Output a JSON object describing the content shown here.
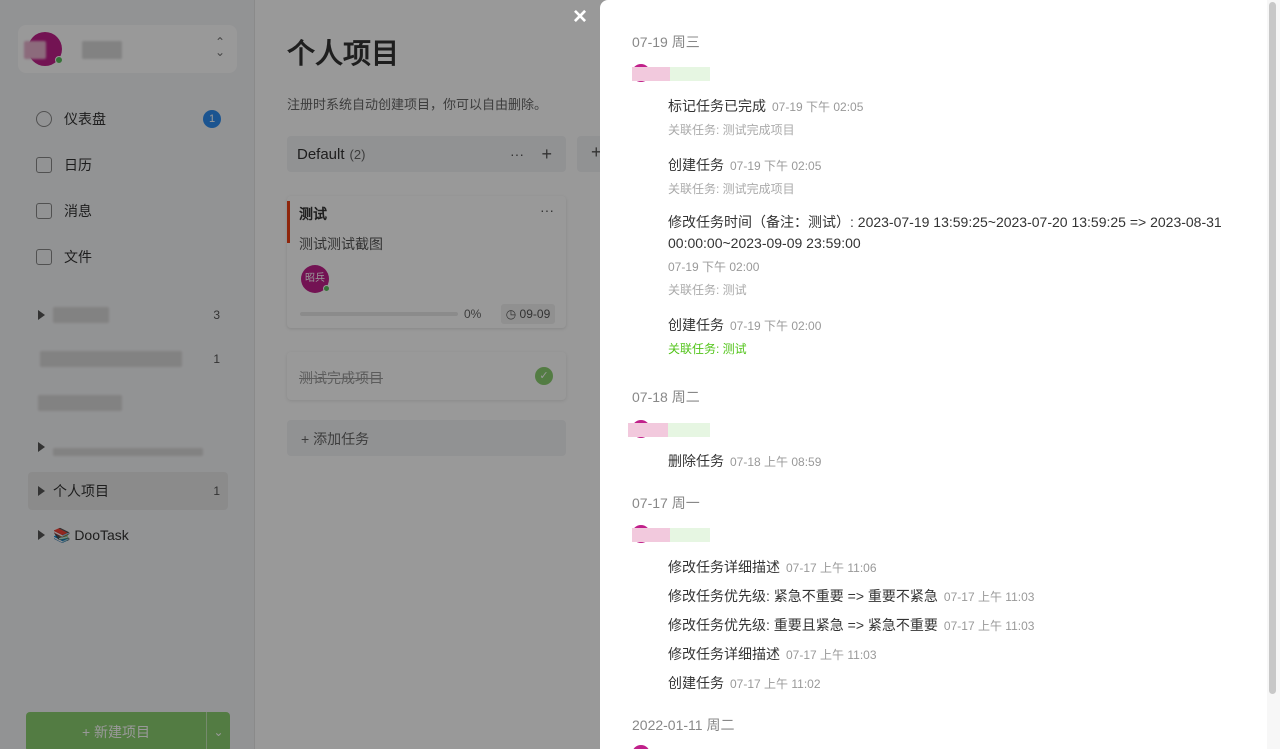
{
  "sidebar": {
    "menu": [
      {
        "label": "仪表盘",
        "badge": "1",
        "icon": "dashboard-icon"
      },
      {
        "label": "日历",
        "icon": "calendar-icon"
      },
      {
        "label": "消息",
        "icon": "message-icon"
      },
      {
        "label": "文件",
        "icon": "file-icon"
      }
    ],
    "projects": [
      {
        "label": "",
        "count": "3"
      },
      {
        "label": "",
        "count": "1"
      },
      {
        "label": "",
        "count": ""
      },
      {
        "label": "",
        "count": ""
      },
      {
        "label": "个人项目",
        "count": "1"
      },
      {
        "label": "📚 DooTask",
        "count": ""
      }
    ],
    "new_project_label": "+  新建项目",
    "new_project_arrow": "⌄"
  },
  "main": {
    "title": "个人项目",
    "description": "注册时系统自动创建项目，你可以自由删除。",
    "column": {
      "name": "Default",
      "count": "(2)",
      "more": "···",
      "add": "+"
    },
    "column2_add": "+",
    "task": {
      "title": "测试",
      "more": "···",
      "desc": "测试测试截图",
      "avatar_text": "昭兵",
      "progress": "0%",
      "progress_value": 0,
      "date": "◷ 09-09"
    },
    "done_task": {
      "title": "测试完成项目",
      "check": "✓"
    },
    "add_task": "+ 添加任务"
  },
  "drawer": {
    "close": "×",
    "days": [
      {
        "date": "07-19 周三",
        "entries": [
          {
            "action": "标记任务已完成",
            "time": "07-19 下午 02:05",
            "related": "关联任务: 测试完成项目"
          },
          {
            "action": "创建任务",
            "time": "07-19 下午 02:05",
            "related": "关联任务: 测试完成项目"
          },
          {
            "action": "修改任务时间（备注：测试）: 2023-07-19 13:59:25~2023-07-20 13:59:25 => 2023-08-31 00:00:00~2023-09-09 23:59:00",
            "time": "07-19 下午 02:00",
            "related": "关联任务: 测试"
          },
          {
            "action": "创建任务",
            "time": "07-19 下午 02:00",
            "related": "关联任务: 测试"
          }
        ]
      },
      {
        "date": "07-18 周二",
        "entries": [
          {
            "action": "删除任务",
            "time": "07-18 上午 08:59"
          }
        ]
      },
      {
        "date": "07-17 周一",
        "entries": [
          {
            "action": "修改任务详细描述",
            "time": "07-17 上午 11:06"
          },
          {
            "action": "修改任务优先级: 紧急不重要 => 重要不紧急",
            "time": "07-17 上午 11:03"
          },
          {
            "action": "修改任务优先级: 重要且紧急 => 紧急不重要",
            "time": "07-17 上午 11:03"
          },
          {
            "action": "修改任务详细描述",
            "time": "07-17 上午 11:03"
          },
          {
            "action": "创建任务",
            "time": "07-17 上午 11:02"
          }
        ]
      },
      {
        "date": "2022-01-11 周二",
        "entries": []
      }
    ]
  },
  "colors": {
    "accent_green": "#8bcf70",
    "link_green": "#52c41a",
    "badge_blue": "#2d8cf0",
    "priority_red": "#ed4014",
    "avatar_magenta": "#c0208a"
  }
}
